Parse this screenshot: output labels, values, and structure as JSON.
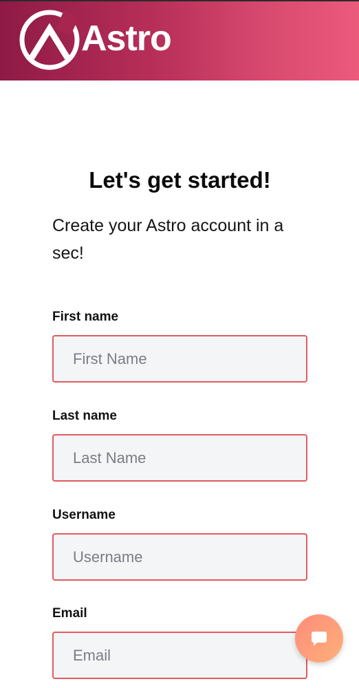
{
  "brand": {
    "name": "Astro",
    "header_gradient": [
      "#8e1a45",
      "#ec5a7c"
    ],
    "logo_icon": "astro-logo-icon"
  },
  "main": {
    "heading": "Let's get started!",
    "subtitle": "Create your Astro account in a sec!"
  },
  "form": {
    "fields": [
      {
        "label": "First name",
        "placeholder": "First Name",
        "value": ""
      },
      {
        "label": "Last name",
        "placeholder": "Last Name",
        "value": ""
      },
      {
        "label": "Username",
        "placeholder": "Username",
        "value": ""
      },
      {
        "label": "Email",
        "placeholder": "Email",
        "value": ""
      }
    ],
    "input_border_color": "#e05a5f",
    "input_background": "#f4f5f7"
  },
  "chat": {
    "icon": "chat-bubble-icon",
    "accent_colors": [
      "#ff8c7a",
      "#fdb07a"
    ]
  }
}
